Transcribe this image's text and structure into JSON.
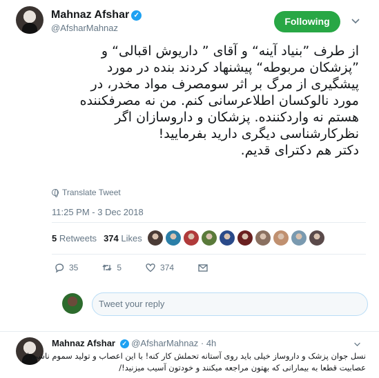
{
  "tweet": {
    "author_name": "Mahnaz Afshar",
    "author_handle": "@AfsharMahnaz",
    "verified_mark": "✓",
    "follow_label": "Following",
    "follow_color": "#28a745",
    "body_lines": [
      "از طرف ”بنیاد آینه“ و آقای ” داریوش اقبالی“ و",
      "”پزشکان مربوطه“ پیشنهاد کردند بنده در مورد",
      "پیشگیری از مرگ بر اثر سومصرف مواد مخدر، در",
      "مورد نالوکسان اطلاعرسانی کنم. من نه مصرفکننده",
      "هستم نه واردکننده. پزشکان و داروسازان اگر",
      "نظرکارشناسی دیگری دارید بفرمایید!",
      "دکتر هم دکترای قدیم."
    ],
    "translate_label": "Translate Tweet",
    "timestamp": "11:25 PM - 3 Dec 2018",
    "retweets_count": "5",
    "retweets_label": "Retweets",
    "likes_count": "374",
    "likes_label": "Likes",
    "liker_avatar_colors": [
      "#4a3b36",
      "#2b7fa8",
      "#b03a3a",
      "#5a7a3a",
      "#2a4a8a",
      "#6a2020",
      "#8a7060",
      "#c09070",
      "#7a9ab0",
      "#5a4a4a"
    ],
    "actions": {
      "reply_count": "35",
      "retweet_count": "5",
      "like_count": "374",
      "icons": [
        "reply-icon",
        "retweet-icon",
        "like-icon",
        "mail-icon"
      ]
    }
  },
  "reply_box": {
    "placeholder": "Tweet your reply"
  },
  "reply_tweet": {
    "author_name": "Mahnaz Afshar",
    "author_handle": "@AfsharMahnaz",
    "age": "· 4h",
    "body_lines": [
      "نسل جوان پزشک و داروساز خیلی باید روی آستانه تحملش کار کنه! با این اعصاب و تولید سموم ناشی از",
      "عصابیت قطعا به بیمارانی که بهتون مراجعه میکنند و خودتون آسیب میزنید!/"
    ]
  },
  "colors": {
    "accent": "#1da1f2",
    "muted": "#657786",
    "text": "#14171a",
    "border": "#e6ecf0"
  }
}
